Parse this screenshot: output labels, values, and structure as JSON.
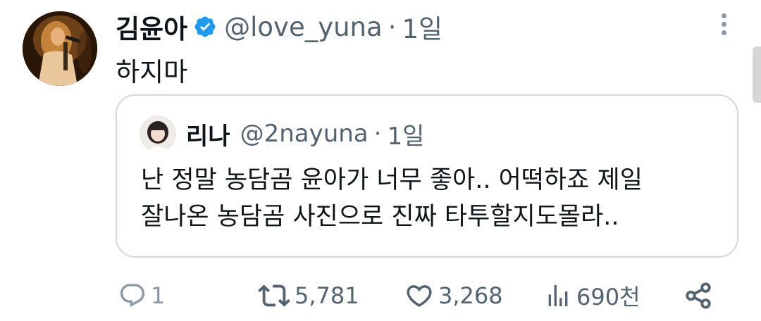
{
  "author": {
    "name": "김윤아",
    "handle": "@love_yuna",
    "time": "1일",
    "verified": true,
    "verified_color": "#1d9bf0"
  },
  "tweet_text": "하지마",
  "quote": {
    "name": "리나",
    "handle": "@2nayuna",
    "time": "1일",
    "text_lines": [
      "난 정말 농담곰 윤아가 너무 좋아.. 어떡하죠 제일",
      "잘나온 농담곰 사진으로 진짜 타투할지도몰라.."
    ]
  },
  "separator": "·",
  "actions": {
    "reply": {
      "icon": "reply-icon",
      "count": "1"
    },
    "retweet": {
      "icon": "retweet-icon",
      "count": "5,781"
    },
    "like": {
      "icon": "heart-icon",
      "count": "3,268"
    },
    "views": {
      "icon": "views-icon",
      "count": "690천"
    },
    "share": {
      "icon": "share-icon"
    }
  },
  "colors": {
    "text_primary": "#0f1419",
    "text_secondary": "#536471",
    "border": "#cfd9de"
  }
}
